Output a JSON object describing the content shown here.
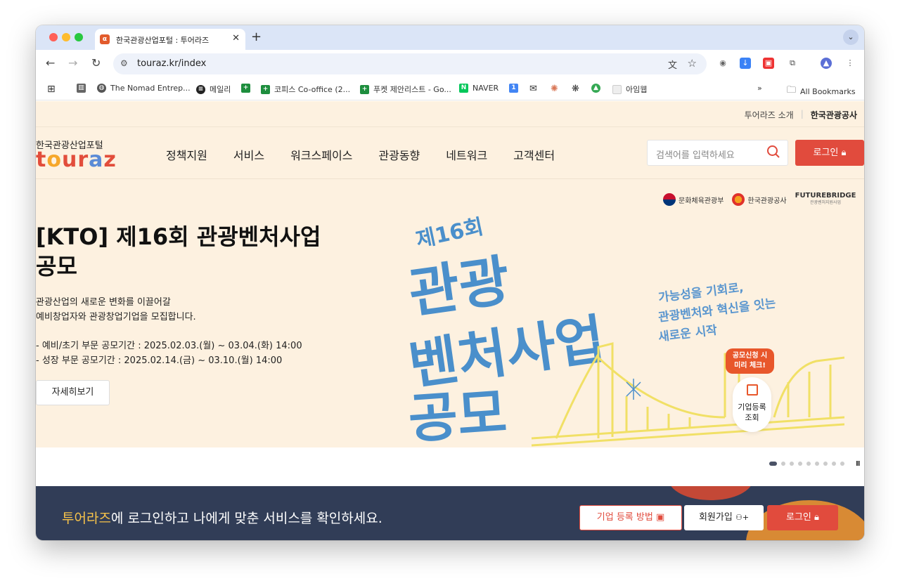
{
  "browser": {
    "tab_title": "한국관광산업포털 : 투어라즈",
    "tab_favicon": "α",
    "url": "touraz.kr/index",
    "bookmarks": [
      {
        "label": "",
        "icon": "apps-grid-icon"
      },
      {
        "label": "",
        "icon": "reading-list-icon"
      },
      {
        "label": "The Nomad Entrep...",
        "icon": "globe-icon"
      },
      {
        "label": "메일리",
        "icon": "maily-icon"
      },
      {
        "label": "",
        "icon": "sheets-icon"
      },
      {
        "label": "코피스 Co-office (2...",
        "icon": "sheets-icon"
      },
      {
        "label": "푸켓 제안리스트 - Go...",
        "icon": "sheets-icon"
      },
      {
        "label": "NAVER",
        "icon": "naver-icon"
      },
      {
        "label": "",
        "icon": "calendar-icon"
      },
      {
        "label": "",
        "icon": "mail-icon"
      },
      {
        "label": "",
        "icon": "claude-icon"
      },
      {
        "label": "",
        "icon": "openai-icon"
      },
      {
        "label": "",
        "icon": "drive-icon"
      },
      {
        "label": "아임웹",
        "icon": "page-icon"
      }
    ],
    "all_bookmarks": "All Bookmarks",
    "overflow": "»"
  },
  "utility": {
    "about": "투어라즈 소개",
    "kto": "한국관광공사"
  },
  "logo": {
    "subtitle": "한국관광산업포털",
    "brand_t": "t",
    "brand_o": "o",
    "brand_ur": "ur",
    "brand_a": "a",
    "brand_z": "z"
  },
  "nav": [
    "정책지원",
    "서비스",
    "워크스페이스",
    "관광동향",
    "네트워크",
    "고객센터"
  ],
  "search": {
    "placeholder": "검색어를 입력하세요"
  },
  "login_label": "로그인",
  "hero": {
    "title_line1": "[KTO] 제16회 관광벤처사업",
    "title_line2": "공모",
    "desc_line1": "관광산업의 새로운 변화를 이끌어갈",
    "desc_line2": "예비창업자와 관광창업기업을 모집합니다.",
    "period_line1": "- 예비/초기 부문 공모기간 : 2025.02.03.(월) ~ 03.04.(화) 14:00",
    "period_line2": "- 성장 부문 공모기간 : 2025.02.14.(금) ~ 03.10.(월) 14:00",
    "detail_label": "자세히보기"
  },
  "banner": {
    "partner1": "문화체육관광부",
    "partner2": "한국관광공사",
    "partner3": "FUTUREBRIDGE",
    "partner3_sub": "관광벤처지원사업",
    "edition": "제16회",
    "headline1": "관광",
    "headline2": "벤처사업",
    "headline3": "공모",
    "tagline1": "가능성을 기회로,",
    "tagline2": "관광벤처와 혁신을 잇는",
    "tagline3": "새로운 시작",
    "bubble1": "공모신청 시",
    "bubble2": "미리 체크!",
    "cta1": "기업등록",
    "cta2": "조회",
    "colors": {
      "blue": "#4a8fcb",
      "yellow": "#f5e866",
      "orange": "#e8572b"
    }
  },
  "slider": {
    "count": 9,
    "active": 0,
    "pause_label": "II"
  },
  "login_banner": {
    "highlight": "투어라즈",
    "text": "에 로그인하고 나에게 맞춘 서비스를 확인하세요.",
    "btn_register": "기업 등록 방법",
    "btn_signup": "회원가입",
    "btn_login": "로그인"
  }
}
